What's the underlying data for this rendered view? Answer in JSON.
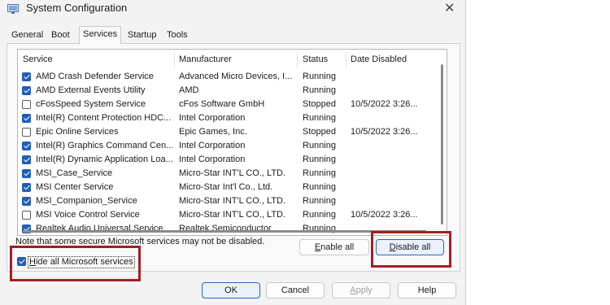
{
  "window": {
    "title": "System Configuration",
    "close_glyph": "✕"
  },
  "tabs": [
    "General",
    "Boot",
    "Services",
    "Startup",
    "Tools"
  ],
  "active_tab": "Services",
  "table": {
    "headers": [
      "Service",
      "Manufacturer",
      "Status",
      "Date Disabled"
    ],
    "rows": [
      {
        "checked": true,
        "service": "AMD Crash Defender Service",
        "manufacturer": "Advanced Micro Devices, I...",
        "status": "Running",
        "date": ""
      },
      {
        "checked": true,
        "service": "AMD External Events Utility",
        "manufacturer": "AMD",
        "status": "Running",
        "date": ""
      },
      {
        "checked": false,
        "service": "cFosSpeed System Service",
        "manufacturer": "cFos Software GmbH",
        "status": "Stopped",
        "date": "10/5/2022 3:26..."
      },
      {
        "checked": true,
        "service": "Intel(R) Content Protection HDC...",
        "manufacturer": "Intel Corporation",
        "status": "Running",
        "date": ""
      },
      {
        "checked": false,
        "service": "Epic Online Services",
        "manufacturer": "Epic Games, Inc.",
        "status": "Stopped",
        "date": "10/5/2022 3:26..."
      },
      {
        "checked": true,
        "service": "Intel(R) Graphics Command Cen...",
        "manufacturer": "Intel Corporation",
        "status": "Running",
        "date": ""
      },
      {
        "checked": true,
        "service": "Intel(R) Dynamic Application Loa...",
        "manufacturer": "Intel Corporation",
        "status": "Running",
        "date": ""
      },
      {
        "checked": true,
        "service": "MSI_Case_Service",
        "manufacturer": "Micro-Star INT'L CO., LTD.",
        "status": "Running",
        "date": ""
      },
      {
        "checked": true,
        "service": "MSI Center Service",
        "manufacturer": "Micro-Star Int'l Co., Ltd.",
        "status": "Running",
        "date": ""
      },
      {
        "checked": true,
        "service": "MSI_Companion_Service",
        "manufacturer": "Micro-Star INT'L CO., LTD.",
        "status": "Running",
        "date": ""
      },
      {
        "checked": false,
        "service": "MSI Voice Control Service",
        "manufacturer": "Micro-Star INT'L CO., LTD.",
        "status": "Running",
        "date": "10/5/2022 3:26..."
      },
      {
        "checked": true,
        "service": "Realtek Audio Universal Service",
        "manufacturer": "Realtek Semiconductor",
        "status": "Running",
        "date": ""
      }
    ]
  },
  "note": "Note that some secure Microsoft services may not be disabled.",
  "buttons": {
    "enable_all": {
      "accel": "E",
      "rest": "nable all"
    },
    "disable_all": {
      "accel": "D",
      "rest": "isable all"
    },
    "ok": "OK",
    "cancel": "Cancel",
    "apply": {
      "accel": "A",
      "rest": "pply"
    },
    "help": "Help"
  },
  "hide_ms": {
    "checked": true,
    "accel": "H",
    "rest": "ide all Microsoft services"
  },
  "highlight_color": "#a31f24",
  "accent_color": "#1f5fb8"
}
